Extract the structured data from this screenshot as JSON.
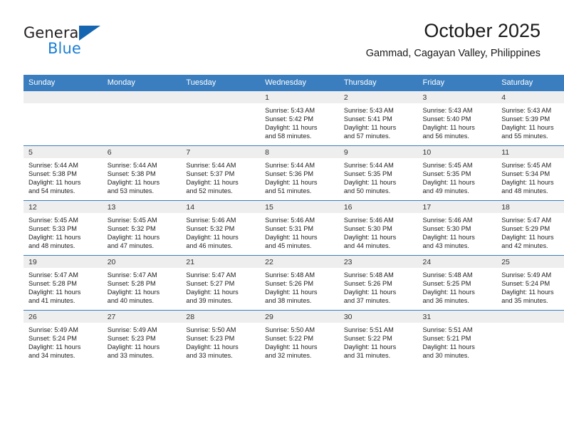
{
  "brand": {
    "name_part1": "General",
    "name_part2": "Blue",
    "triangle_color": "#1565b0",
    "blue_color": "#1b7fd4"
  },
  "header": {
    "title": "October 2025",
    "subtitle": "Gammad, Cagayan Valley, Philippines",
    "header_bg": "#3a7ebf",
    "daynum_bg": "#eeeeee"
  },
  "weekday_headers": [
    "Sunday",
    "Monday",
    "Tuesday",
    "Wednesday",
    "Thursday",
    "Friday",
    "Saturday"
  ],
  "weeks": [
    [
      {
        "day": "",
        "sunrise": "",
        "sunset": "",
        "daylight1": "",
        "daylight2": ""
      },
      {
        "day": "",
        "sunrise": "",
        "sunset": "",
        "daylight1": "",
        "daylight2": ""
      },
      {
        "day": "",
        "sunrise": "",
        "sunset": "",
        "daylight1": "",
        "daylight2": ""
      },
      {
        "day": "1",
        "sunrise": "Sunrise: 5:43 AM",
        "sunset": "Sunset: 5:42 PM",
        "daylight1": "Daylight: 11 hours",
        "daylight2": "and 58 minutes."
      },
      {
        "day": "2",
        "sunrise": "Sunrise: 5:43 AM",
        "sunset": "Sunset: 5:41 PM",
        "daylight1": "Daylight: 11 hours",
        "daylight2": "and 57 minutes."
      },
      {
        "day": "3",
        "sunrise": "Sunrise: 5:43 AM",
        "sunset": "Sunset: 5:40 PM",
        "daylight1": "Daylight: 11 hours",
        "daylight2": "and 56 minutes."
      },
      {
        "day": "4",
        "sunrise": "Sunrise: 5:43 AM",
        "sunset": "Sunset: 5:39 PM",
        "daylight1": "Daylight: 11 hours",
        "daylight2": "and 55 minutes."
      }
    ],
    [
      {
        "day": "5",
        "sunrise": "Sunrise: 5:44 AM",
        "sunset": "Sunset: 5:38 PM",
        "daylight1": "Daylight: 11 hours",
        "daylight2": "and 54 minutes."
      },
      {
        "day": "6",
        "sunrise": "Sunrise: 5:44 AM",
        "sunset": "Sunset: 5:38 PM",
        "daylight1": "Daylight: 11 hours",
        "daylight2": "and 53 minutes."
      },
      {
        "day": "7",
        "sunrise": "Sunrise: 5:44 AM",
        "sunset": "Sunset: 5:37 PM",
        "daylight1": "Daylight: 11 hours",
        "daylight2": "and 52 minutes."
      },
      {
        "day": "8",
        "sunrise": "Sunrise: 5:44 AM",
        "sunset": "Sunset: 5:36 PM",
        "daylight1": "Daylight: 11 hours",
        "daylight2": "and 51 minutes."
      },
      {
        "day": "9",
        "sunrise": "Sunrise: 5:44 AM",
        "sunset": "Sunset: 5:35 PM",
        "daylight1": "Daylight: 11 hours",
        "daylight2": "and 50 minutes."
      },
      {
        "day": "10",
        "sunrise": "Sunrise: 5:45 AM",
        "sunset": "Sunset: 5:35 PM",
        "daylight1": "Daylight: 11 hours",
        "daylight2": "and 49 minutes."
      },
      {
        "day": "11",
        "sunrise": "Sunrise: 5:45 AM",
        "sunset": "Sunset: 5:34 PM",
        "daylight1": "Daylight: 11 hours",
        "daylight2": "and 48 minutes."
      }
    ],
    [
      {
        "day": "12",
        "sunrise": "Sunrise: 5:45 AM",
        "sunset": "Sunset: 5:33 PM",
        "daylight1": "Daylight: 11 hours",
        "daylight2": "and 48 minutes."
      },
      {
        "day": "13",
        "sunrise": "Sunrise: 5:45 AM",
        "sunset": "Sunset: 5:32 PM",
        "daylight1": "Daylight: 11 hours",
        "daylight2": "and 47 minutes."
      },
      {
        "day": "14",
        "sunrise": "Sunrise: 5:46 AM",
        "sunset": "Sunset: 5:32 PM",
        "daylight1": "Daylight: 11 hours",
        "daylight2": "and 46 minutes."
      },
      {
        "day": "15",
        "sunrise": "Sunrise: 5:46 AM",
        "sunset": "Sunset: 5:31 PM",
        "daylight1": "Daylight: 11 hours",
        "daylight2": "and 45 minutes."
      },
      {
        "day": "16",
        "sunrise": "Sunrise: 5:46 AM",
        "sunset": "Sunset: 5:30 PM",
        "daylight1": "Daylight: 11 hours",
        "daylight2": "and 44 minutes."
      },
      {
        "day": "17",
        "sunrise": "Sunrise: 5:46 AM",
        "sunset": "Sunset: 5:30 PM",
        "daylight1": "Daylight: 11 hours",
        "daylight2": "and 43 minutes."
      },
      {
        "day": "18",
        "sunrise": "Sunrise: 5:47 AM",
        "sunset": "Sunset: 5:29 PM",
        "daylight1": "Daylight: 11 hours",
        "daylight2": "and 42 minutes."
      }
    ],
    [
      {
        "day": "19",
        "sunrise": "Sunrise: 5:47 AM",
        "sunset": "Sunset: 5:28 PM",
        "daylight1": "Daylight: 11 hours",
        "daylight2": "and 41 minutes."
      },
      {
        "day": "20",
        "sunrise": "Sunrise: 5:47 AM",
        "sunset": "Sunset: 5:28 PM",
        "daylight1": "Daylight: 11 hours",
        "daylight2": "and 40 minutes."
      },
      {
        "day": "21",
        "sunrise": "Sunrise: 5:47 AM",
        "sunset": "Sunset: 5:27 PM",
        "daylight1": "Daylight: 11 hours",
        "daylight2": "and 39 minutes."
      },
      {
        "day": "22",
        "sunrise": "Sunrise: 5:48 AM",
        "sunset": "Sunset: 5:26 PM",
        "daylight1": "Daylight: 11 hours",
        "daylight2": "and 38 minutes."
      },
      {
        "day": "23",
        "sunrise": "Sunrise: 5:48 AM",
        "sunset": "Sunset: 5:26 PM",
        "daylight1": "Daylight: 11 hours",
        "daylight2": "and 37 minutes."
      },
      {
        "day": "24",
        "sunrise": "Sunrise: 5:48 AM",
        "sunset": "Sunset: 5:25 PM",
        "daylight1": "Daylight: 11 hours",
        "daylight2": "and 36 minutes."
      },
      {
        "day": "25",
        "sunrise": "Sunrise: 5:49 AM",
        "sunset": "Sunset: 5:24 PM",
        "daylight1": "Daylight: 11 hours",
        "daylight2": "and 35 minutes."
      }
    ],
    [
      {
        "day": "26",
        "sunrise": "Sunrise: 5:49 AM",
        "sunset": "Sunset: 5:24 PM",
        "daylight1": "Daylight: 11 hours",
        "daylight2": "and 34 minutes."
      },
      {
        "day": "27",
        "sunrise": "Sunrise: 5:49 AM",
        "sunset": "Sunset: 5:23 PM",
        "daylight1": "Daylight: 11 hours",
        "daylight2": "and 33 minutes."
      },
      {
        "day": "28",
        "sunrise": "Sunrise: 5:50 AM",
        "sunset": "Sunset: 5:23 PM",
        "daylight1": "Daylight: 11 hours",
        "daylight2": "and 33 minutes."
      },
      {
        "day": "29",
        "sunrise": "Sunrise: 5:50 AM",
        "sunset": "Sunset: 5:22 PM",
        "daylight1": "Daylight: 11 hours",
        "daylight2": "and 32 minutes."
      },
      {
        "day": "30",
        "sunrise": "Sunrise: 5:51 AM",
        "sunset": "Sunset: 5:22 PM",
        "daylight1": "Daylight: 11 hours",
        "daylight2": "and 31 minutes."
      },
      {
        "day": "31",
        "sunrise": "Sunrise: 5:51 AM",
        "sunset": "Sunset: 5:21 PM",
        "daylight1": "Daylight: 11 hours",
        "daylight2": "and 30 minutes."
      },
      {
        "day": "",
        "sunrise": "",
        "sunset": "",
        "daylight1": "",
        "daylight2": ""
      }
    ]
  ]
}
